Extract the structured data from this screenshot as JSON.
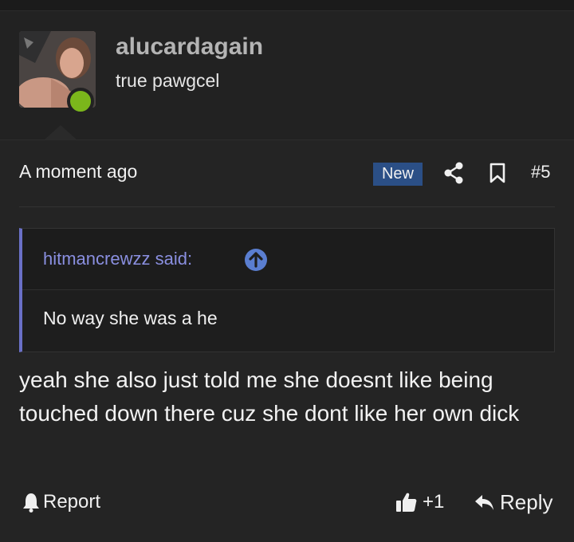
{
  "user": {
    "username": "alucardagain",
    "title": "true pawgcel",
    "online_color": "#7bb61b"
  },
  "post": {
    "timestamp": "A moment ago",
    "badge": "New",
    "number": "#5",
    "share_icon": "share-icon",
    "bookmark_icon": "bookmark-icon"
  },
  "quote": {
    "author": "hitmancrewzz said:",
    "text": "No way she was a he",
    "accent_color": "#6a70c7"
  },
  "message": "yeah she also just told me she doesnt like being touched down there cuz she dont like her own dick",
  "footer": {
    "report_label": "Report",
    "like_count": "+1",
    "reply_label": "Reply"
  }
}
